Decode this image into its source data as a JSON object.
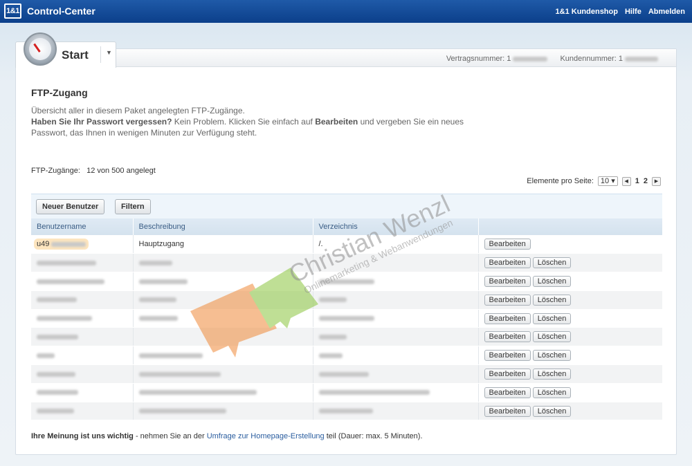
{
  "topbar": {
    "logo": "1&1",
    "title": "Control-Center",
    "links": [
      "1&1 Kundenshop",
      "Hilfe",
      "Abmelden"
    ]
  },
  "tab": {
    "label": "Start"
  },
  "contract": {
    "vertrag_label": "Vertragsnummer: 1",
    "kunden_label": "Kundennummer: 1"
  },
  "page": {
    "title": "FTP-Zugang",
    "line1": "Übersicht aller in diesem Paket angelegten FTP-Zugänge.",
    "line2_bold": "Haben Sie Ihr Passwort vergessen?",
    "line2_rest": " Kein Problem. Klicken Sie einfach auf ",
    "line2_bold2": "Bearbeiten",
    "line2_end": " und vergeben Sie ein neues",
    "line3": "Passwort, das Ihnen in wenigen Minuten zur Verfügung steht."
  },
  "count": {
    "label": "FTP-Zugänge:",
    "value": "12 von 500 angelegt"
  },
  "paging": {
    "label": "Elemente pro Seite:",
    "per_page": "10",
    "pages": [
      "1",
      "2"
    ]
  },
  "toolbar": {
    "new_user": "Neuer Benutzer",
    "filter": "Filtern"
  },
  "table": {
    "headers": [
      "Benutzername",
      "Beschreibung",
      "Verzeichnis",
      ""
    ],
    "edit_label": "Bearbeiten",
    "delete_label": "Löschen",
    "first_row": {
      "user": "u49",
      "description": "Hauptzugang",
      "dir": "/."
    }
  },
  "footer": {
    "bold": "Ihre Meinung ist uns wichtig",
    "pre": " - nehmen Sie an der ",
    "link": "Umfrage zur Homepage-Erstellung",
    "post": " teil (Dauer: max. 5 Minuten)."
  },
  "watermark": {
    "name": "Christian Wenzl",
    "tagline": "Onlinemarketing & Webanwendungen"
  }
}
